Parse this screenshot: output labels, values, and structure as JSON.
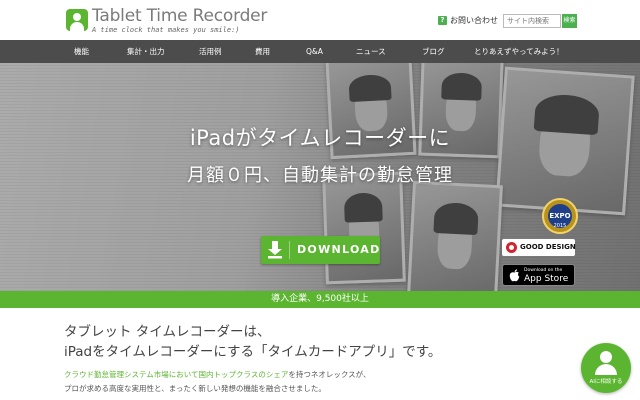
{
  "header": {
    "logo_title": "Tablet Time Recorder",
    "logo_tagline": "A time clock that makes you smile:)",
    "contact_icon": "?",
    "contact_label": "お問い合わせ",
    "search_placeholder": "サイト内検索",
    "search_button": "検索"
  },
  "nav": {
    "items": [
      "機能",
      "集計・出力",
      "活用例",
      "費用",
      "Q&A",
      "ニュース",
      "ブログ",
      "とりあえずやってみよう！"
    ]
  },
  "hero": {
    "title": "iPadがタイムレコーダーに",
    "subtitle": "月額０円、自動集計の勤怠管理",
    "download_label": "DOWNLOAD",
    "good_design_label": "GOOD DESIGN",
    "appstore_small": "Download on the",
    "appstore_big": "App Store",
    "expo_year": "2015"
  },
  "stats": {
    "text": "導入企業、9,500社以上"
  },
  "intro": {
    "heading_line1": "タブレット タイムレコーダーは、",
    "heading_line2": "iPadをタイムレコーダーにする「タイムカードアプリ」です。",
    "para1_highlight": "クラウド勤怠管理システム市場において国内トップクラスのシェア",
    "para1_rest": "を持つネオレックスが、",
    "para2": "プロが求める高度な実用性と、まったく新しい発想の機能を融合させました。"
  },
  "consult": {
    "label": "AIに相談する"
  },
  "colors": {
    "brand_green": "#5cb531",
    "nav_bg": "#4c4c4c"
  }
}
